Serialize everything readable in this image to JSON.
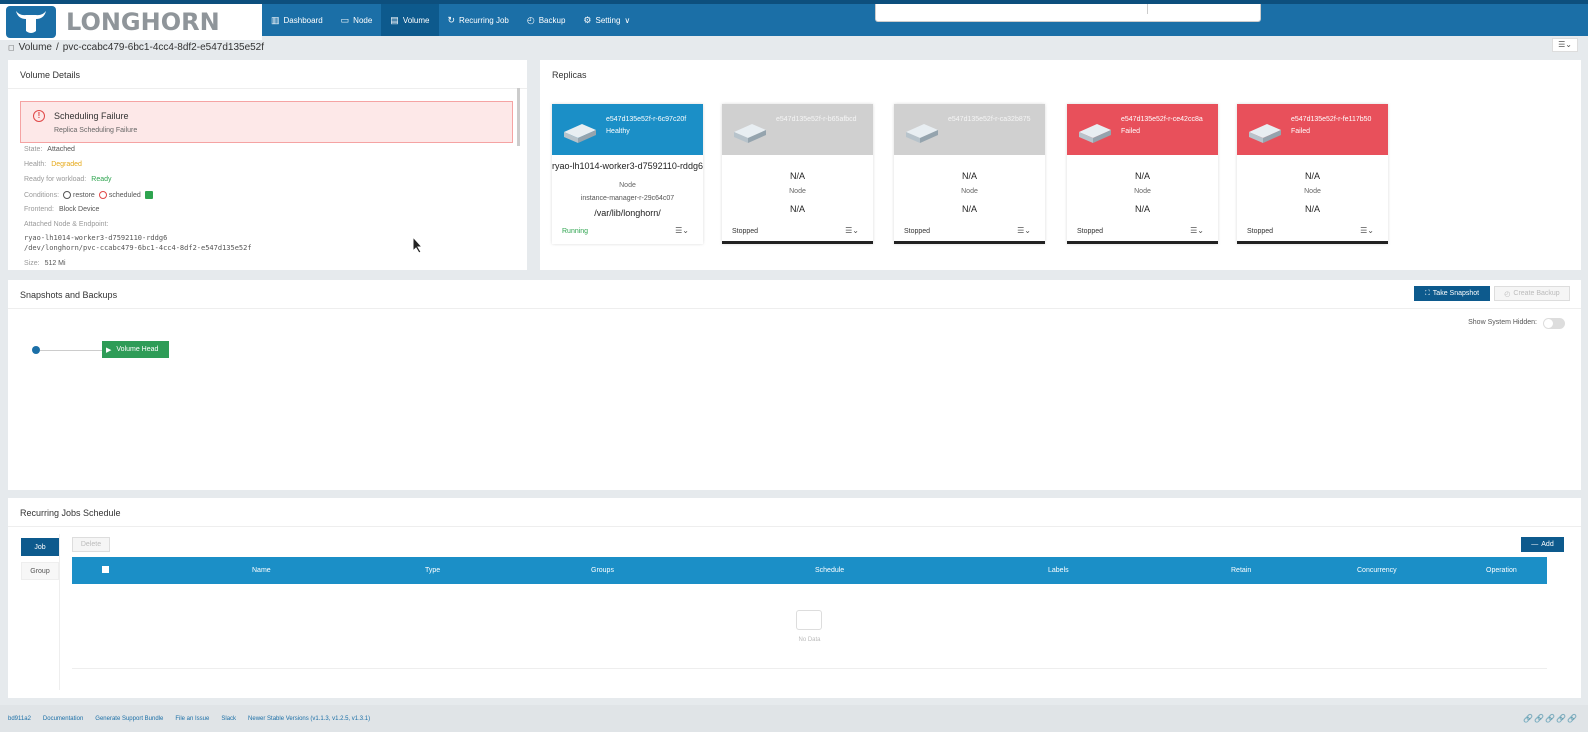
{
  "brand": {
    "name": "LONGHORN"
  },
  "nav": [
    {
      "label": "Dashboard",
      "icon": "chart-icon"
    },
    {
      "label": "Node",
      "icon": "node-icon"
    },
    {
      "label": "Volume",
      "icon": "volume-icon",
      "active": true
    },
    {
      "label": "Recurring Job",
      "icon": "recurring-icon"
    },
    {
      "label": "Backup",
      "icon": "backup-icon"
    },
    {
      "label": "Setting",
      "icon": "gear-icon"
    }
  ],
  "breadcrumb": {
    "root": "Volume",
    "separator": "/",
    "current": "pvc-ccabc479-6bc1-4cc4-8df2-e547d135e52f"
  },
  "volume_details": {
    "title": "Volume Details",
    "alert": {
      "title": "Scheduling Failure",
      "subtitle": "Replica Scheduling Failure"
    },
    "state_label": "State:",
    "state": "Attached",
    "health_label": "Health:",
    "health": "Degraded",
    "ready_label": "Ready for workload:",
    "ready": "Ready",
    "conditions_label": "Conditions:",
    "cond_restore": "restore",
    "cond_scheduled": "scheduled",
    "frontend_label": "Frontend:",
    "frontend": "Block Device",
    "attached_label": "Attached Node & Endpoint:",
    "attached_node": "ryao-lh1014-worker3-d7592110-rddg6",
    "endpoint": "/dev/longhorn/pvc-ccabc479-6bc1-4cc4-8df2-e547d135e52f",
    "size_label": "Size:",
    "size": "512 Mi"
  },
  "replicas": {
    "title": "Replicas",
    "items": [
      {
        "name": "e547d135e52f-r-6c97c20f",
        "status": "Healthy",
        "node": "ryao-lh1014-worker3-d7592110-rddg6",
        "node_label": "Node",
        "instance_manager": "instance-manager-r-29c64c07",
        "path": "/var/lib/longhorn/",
        "state": "Running"
      },
      {
        "name": "e547d135e52f-r-b65afbcd",
        "status": "",
        "node": "N/A",
        "node_label": "Node",
        "path": "N/A",
        "state": "Stopped"
      },
      {
        "name": "e547d135e52f-r-ca32b875",
        "status": "",
        "node": "N/A",
        "node_label": "Node",
        "path": "N/A",
        "state": "Stopped"
      },
      {
        "name": "e547d135e52f-r-ce42cc8a",
        "status": "Failed",
        "node": "N/A",
        "node_label": "Node",
        "path": "N/A",
        "state": "Stopped"
      },
      {
        "name": "e547d135e52f-r-fe117b50",
        "status": "Failed",
        "node": "N/A",
        "node_label": "Node",
        "path": "N/A",
        "state": "Stopped"
      }
    ]
  },
  "snapshots": {
    "title": "Snapshots and Backups",
    "take_snapshot": "Take Snapshot",
    "create_backup": "Create Backup",
    "show_hidden": "Show System Hidden:",
    "volume_head": "Volume Head"
  },
  "recurring": {
    "title": "Recurring Jobs Schedule",
    "tab_job": "Job",
    "tab_group": "Group",
    "delete": "Delete",
    "add": "Add",
    "columns": [
      "Name",
      "Type",
      "Groups",
      "Schedule",
      "Labels",
      "Retain",
      "Concurrency",
      "Operation"
    ],
    "empty": "No Data"
  },
  "footer": {
    "links": [
      "bd911a2",
      "Documentation",
      "Generate Support Bundle",
      "File an Issue",
      "Slack",
      "Newer Stable Versions (v1.1.3, v1.2.5, v1.3.1)"
    ]
  },
  "colors": {
    "header": "#1b6fa7",
    "healthy": "#1b8fc7",
    "failed": "#e8505b",
    "stopped": "#d0d0d0",
    "ok": "#2ea44f",
    "warn": "#e6a817"
  }
}
